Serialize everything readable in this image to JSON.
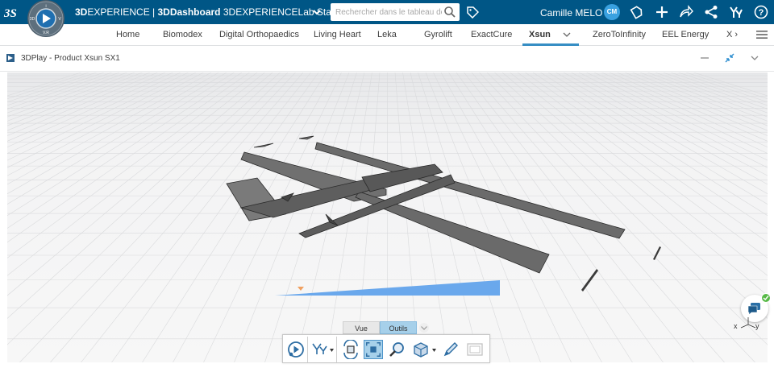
{
  "topbar": {
    "brand_bold": "3D",
    "brand_rest": "EXPERIENCE | ",
    "brand_dash": "3DDashboard",
    "brand_tenant": " 3DEXPERIENCELab Sta...",
    "search_placeholder": "Rechercher dans le tableau de",
    "user_name": "Camille MELO",
    "user_initials": "CM",
    "compass_labels": [
      "3D",
      "V",
      "V.R"
    ],
    "icons": [
      "dassault-logo",
      "compass",
      "search-icon",
      "tag-icon",
      "share-icon",
      "plus-icon",
      "forward-icon",
      "network-icon",
      "apps-icon",
      "help-icon"
    ]
  },
  "tabs": {
    "items": [
      "Home",
      "Biomodex",
      "Digital Orthopaedics",
      "Living Heart",
      "Leka",
      "Gyrolift",
      "ExactCure",
      "Xsun",
      "ZeroToInfinity",
      "EEL Energy",
      "X ›"
    ],
    "active": "Xsun"
  },
  "widget": {
    "title": "3DPlay - Product Xsun SX1"
  },
  "viewer": {
    "mode_tabs": [
      "Vue",
      "Outils"
    ],
    "active_mode": "Outils",
    "axis_x": "x",
    "axis_y": "y"
  },
  "colors": {
    "topbar_bg": "#005686",
    "accent": "#368ec4",
    "model": "#6b6b6b",
    "blue_plane": "#6aa8ec",
    "chat_check": "#57b947"
  }
}
